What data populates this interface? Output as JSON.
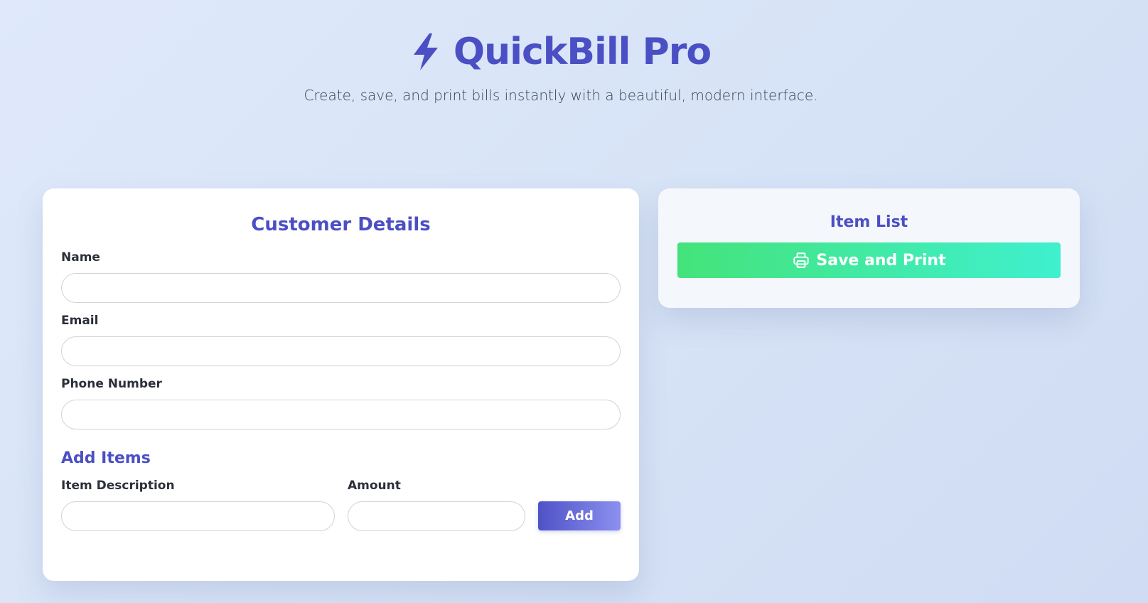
{
  "header": {
    "title": "QuickBill Pro",
    "subtitle": "Create, save, and print bills instantly with a beautiful, modern interface.",
    "icon": "bolt-icon"
  },
  "customer_form": {
    "title": "Customer Details",
    "name_label": "Name",
    "name_value": "",
    "email_label": "Email",
    "email_value": "",
    "phone_label": "Phone Number",
    "phone_value": ""
  },
  "add_items": {
    "title": "Add Items",
    "description_label": "Item Description",
    "description_value": "",
    "amount_label": "Amount",
    "amount_value": "",
    "add_button_label": "Add"
  },
  "item_list": {
    "title": "Item List",
    "print_button_label": "Save and Print",
    "print_icon": "printer-icon"
  },
  "colors": {
    "accent": "#4b4fc4",
    "print_gradient_start": "#44e37a",
    "print_gradient_end": "#3ff0cf",
    "add_gradient_start": "#4f52c6",
    "add_gradient_end": "#8b90ef"
  }
}
